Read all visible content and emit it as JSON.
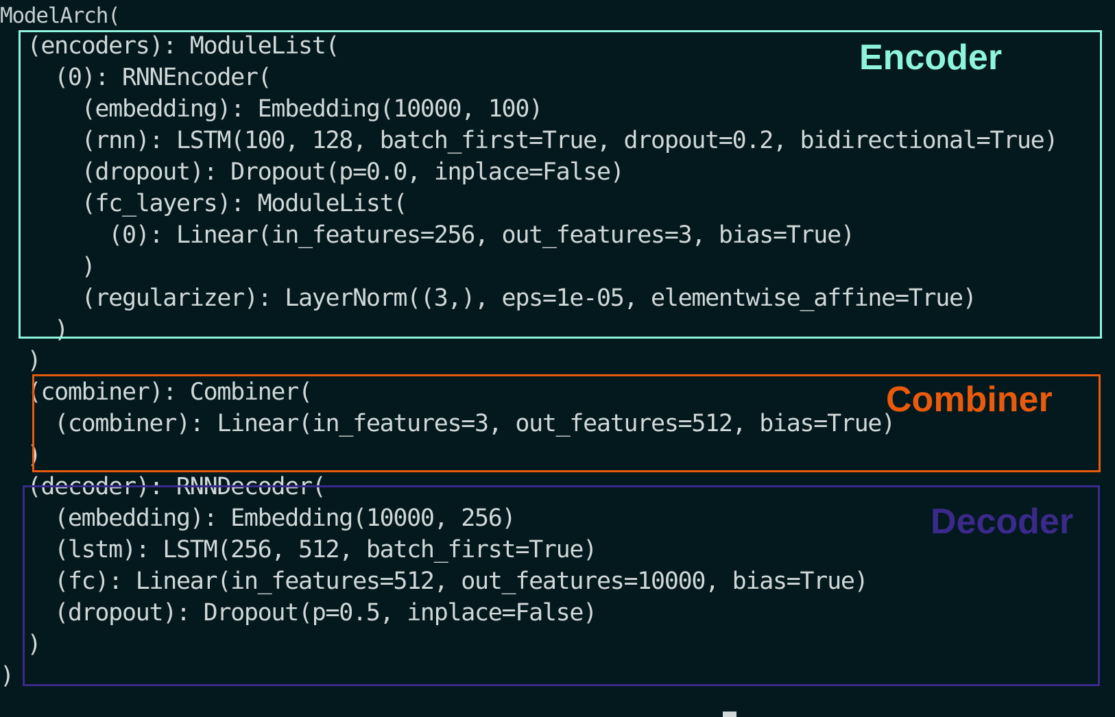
{
  "terminal": {
    "lines": [
      "ModelArch(",
      "  (encoders): ModuleList(",
      "    (0): RNNEncoder(",
      "      (embedding): Embedding(10000, 100)",
      "      (rnn): LSTM(100, 128, batch_first=True, dropout=0.2, bidirectional=True)",
      "      (dropout): Dropout(p=0.0, inplace=False)",
      "      (fc_layers): ModuleList(",
      "        (0): Linear(in_features=256, out_features=3, bias=True)",
      "      )",
      "      (regularizer): LayerNorm((3,), eps=1e-05, elementwise_affine=True)",
      "    )",
      "  )",
      "  (combiner): Combiner(",
      "    (combiner): Linear(in_features=3, out_features=512, bias=True)",
      "  )",
      "  (decoder): RNNDecoder(",
      "    (embedding): Embedding(10000, 256)",
      "    (lstm): LSTM(256, 512, batch_first=True)",
      "    (fc): Linear(in_features=512, out_features=10000, bias=True)",
      "    (dropout): Dropout(p=0.5, inplace=False)",
      "  )",
      ")"
    ]
  },
  "annotations": {
    "encoder": {
      "label": "Encoder",
      "color": "#8ff4dc"
    },
    "combiner": {
      "label": "Combiner",
      "color": "#ea5a0c"
    },
    "decoder": {
      "label": "Decoder",
      "color": "#3a2a8c"
    }
  },
  "colors": {
    "background": "#04191d",
    "text": "#d0d8d9"
  }
}
